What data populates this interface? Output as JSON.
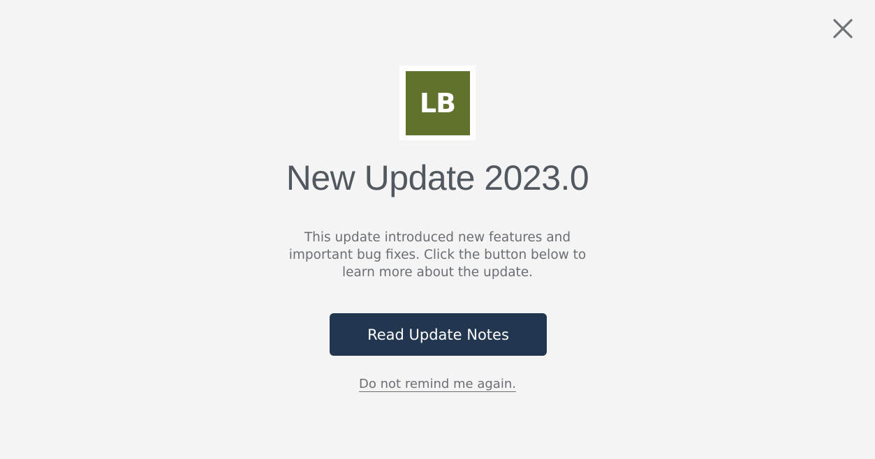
{
  "dialog": {
    "close_icon": "close-icon",
    "logo": {
      "text": "LB",
      "color": "#61722d"
    },
    "title": "New Update 2023.0",
    "body": "This update introduced new features and important bug fixes. Click the button below to learn more about the update.",
    "primary_button": {
      "label": "Read Update Notes",
      "color": "#22364f"
    },
    "dismiss_link": "Do not remind me again."
  },
  "colors": {
    "background": "#f4f4f4",
    "title_text": "#525860",
    "body_text": "#6a6e74"
  }
}
